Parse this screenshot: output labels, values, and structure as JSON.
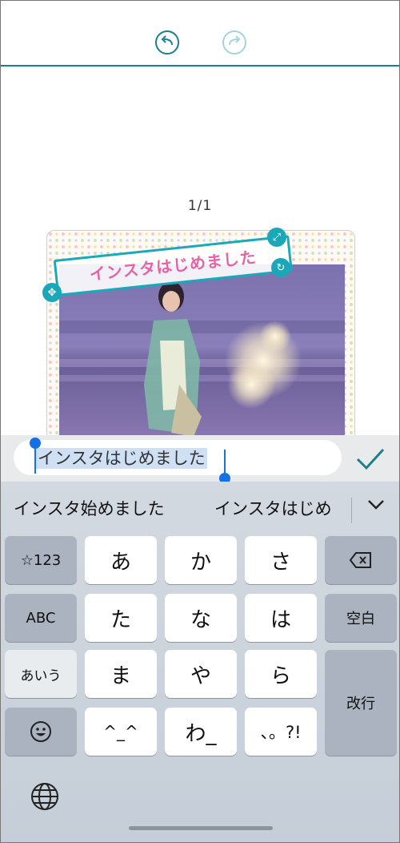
{
  "toolbar": {
    "undo_icon": "undo-arrow-icon",
    "redo_icon": "redo-arrow-icon",
    "accent_color": "#1b7f8e",
    "redo_disabled_color": "#a6d3da"
  },
  "canvas": {
    "page_indicator": "1/1",
    "sticker_text": "インスタはじめました",
    "sticker_text_color": "#e464a6",
    "handle_color": "#1aa7b8"
  },
  "input": {
    "value": "インスタはじめました",
    "confirm_icon": "checkmark-icon"
  },
  "keyboard": {
    "candidates": [
      "インスタ始めました",
      "インスタはじめ"
    ],
    "expand_icon": "chevron-down-icon",
    "keys": {
      "num": "☆123",
      "abc": "ABC",
      "kana": "あいう",
      "emoji_icon": "emoji-icon",
      "a": "あ",
      "ka": "か",
      "sa": "さ",
      "ta": "た",
      "na": "な",
      "ha": "は",
      "ma": "ま",
      "ya": "や",
      "ra": "ら",
      "kaomoji": "^_^",
      "wa": "わ_",
      "punct": "、。?!",
      "space": "空白",
      "return": "改行",
      "delete_icon": "backspace-icon"
    },
    "globe_icon": "globe-icon"
  }
}
